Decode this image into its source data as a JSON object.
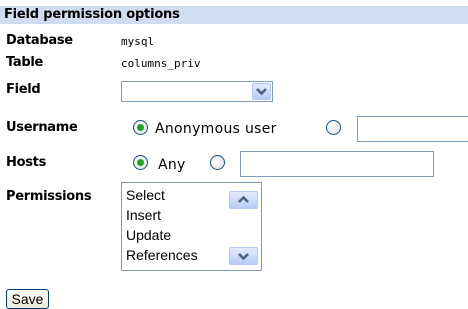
{
  "header": {
    "title": "Field permission options"
  },
  "database": {
    "label": "Database",
    "value": "mysql"
  },
  "table": {
    "label": "Table",
    "value": "columns_priv"
  },
  "field": {
    "label": "Field",
    "selected_value": "",
    "icon": "chevron-down-icon"
  },
  "username": {
    "label": "Username",
    "option_anonymous": "Anonymous user",
    "anonymous_selected": true,
    "text_value": ""
  },
  "hosts": {
    "label": "Hosts",
    "option_any": "Any",
    "any_selected": true,
    "text_value": ""
  },
  "permissions": {
    "label": "Permissions",
    "items": [
      "Select",
      "Insert",
      "Update",
      "References"
    ],
    "scroll_up_icon": "chevron-up-icon",
    "scroll_down_icon": "chevron-down-icon"
  },
  "actions": {
    "save_label": "Save"
  },
  "colors": {
    "header_bg": "#d0dcf0",
    "radio_checked": "#21a121",
    "border": "#7f9db9",
    "arrow": "#4d6185"
  }
}
